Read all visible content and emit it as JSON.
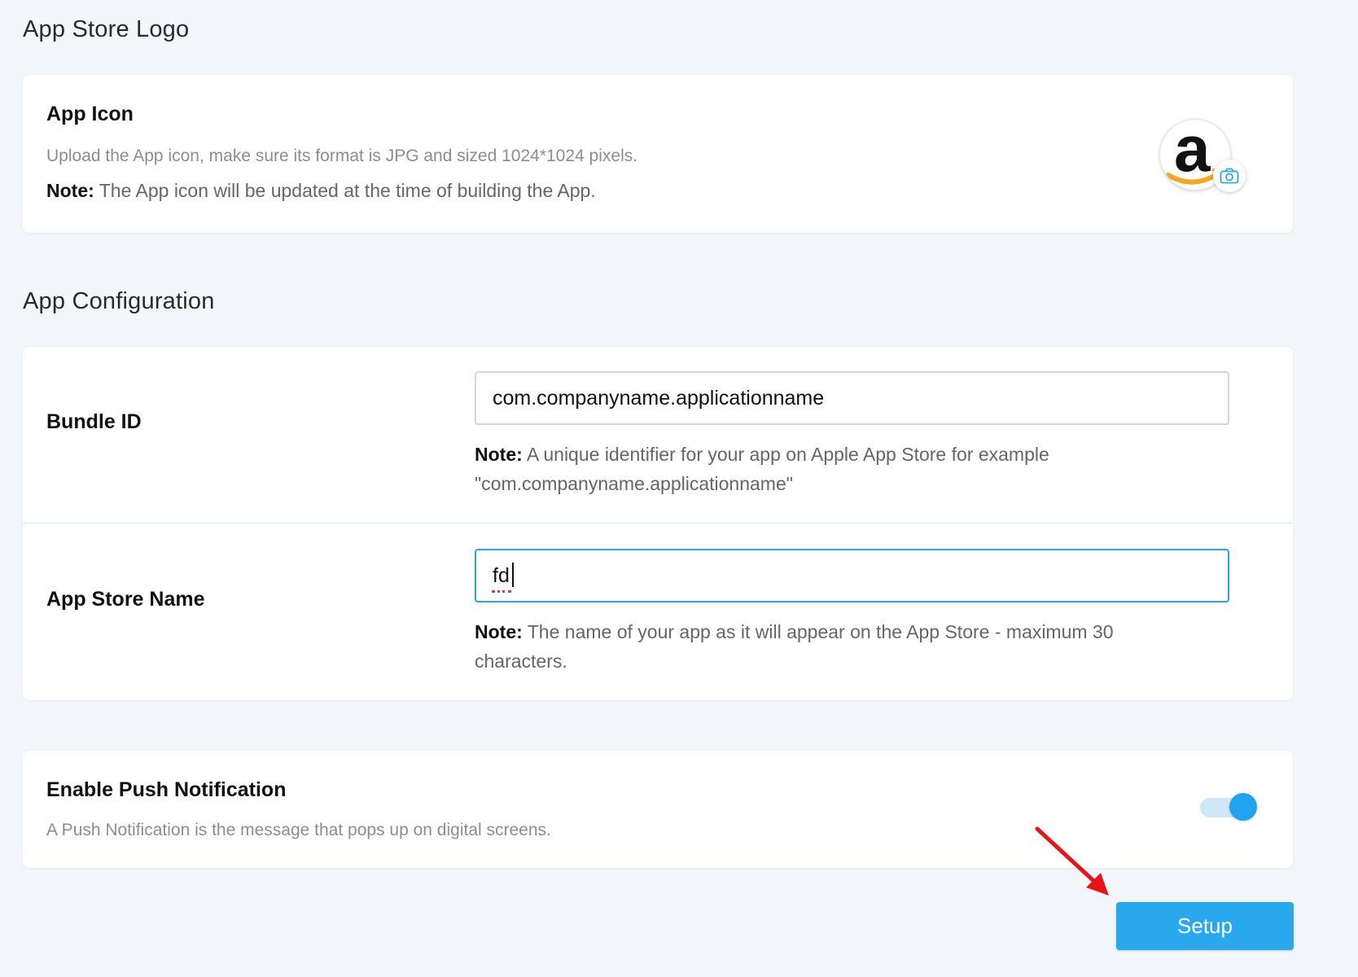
{
  "logo_section": {
    "title": "App Store Logo",
    "app_icon": {
      "label": "App Icon",
      "description": "Upload the App icon, make sure its format is JPG and sized 1024*1024 pixels.",
      "note_prefix": "Note:",
      "note_text": " The App icon will be updated at the time of building the App.",
      "logo_letter": "a",
      "badge_icon": "camera-icon"
    }
  },
  "config_section": {
    "title": "App Configuration",
    "bundle_id": {
      "label": "Bundle ID",
      "value": "com.companyname.applicationname",
      "note_prefix": "Note:",
      "note_line1": " A unique identifier for your app on Apple App Store for example",
      "note_line2": "\"com.companyname.applicationname\""
    },
    "app_store_name": {
      "label": "App Store Name",
      "value": "fd",
      "note_prefix": "Note:",
      "note_line1": " The name of your app as it will appear on the App Store - maximum 30",
      "note_line2": "characters."
    }
  },
  "push_section": {
    "label": "Enable Push Notification",
    "description": "A Push Notification is the message that pops up on digital screens.",
    "enabled": true
  },
  "actions": {
    "setup_label": "Setup"
  },
  "colors": {
    "accent": "#2aa8ee",
    "toggle_on": "#21a4f0",
    "annotation_arrow": "#e8141b",
    "background": "#f3f7fc"
  }
}
